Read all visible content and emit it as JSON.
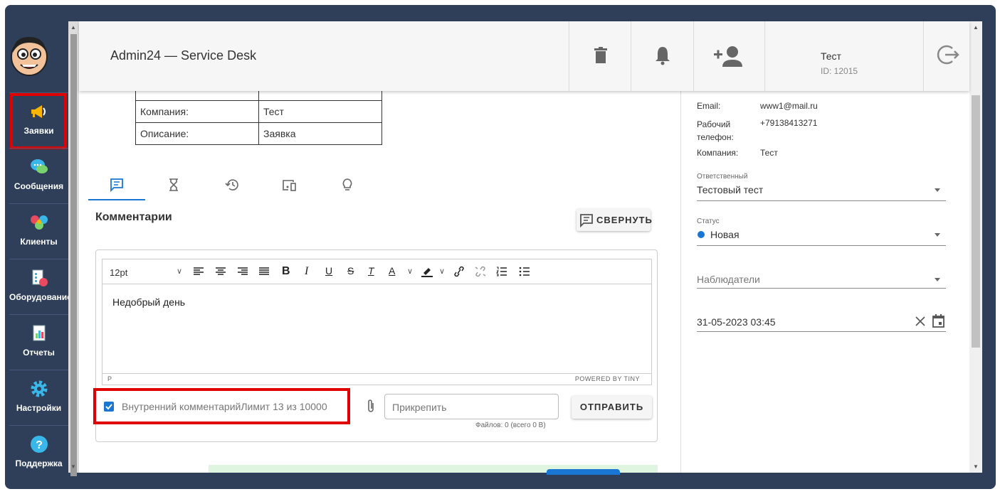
{
  "app": {
    "title": "Admin24 — Service Desk"
  },
  "user": {
    "name": "Тест",
    "id": "ID: 12015"
  },
  "sidebar": {
    "items": [
      {
        "label": "Заявки",
        "icon": "megaphone-icon"
      },
      {
        "label": "Сообщения",
        "icon": "chat-bubbles-icon"
      },
      {
        "label": "Клиенты",
        "icon": "people-icon"
      },
      {
        "label": "Оборудование",
        "icon": "equipment-icon"
      },
      {
        "label": "Отчеты",
        "icon": "report-icon"
      },
      {
        "label": "Настройки",
        "icon": "gear-icon"
      },
      {
        "label": "Поддержка",
        "icon": "help-icon"
      }
    ]
  },
  "ticket": {
    "rows": [
      {
        "key": "Компания:",
        "value": "Тест"
      },
      {
        "key": "Описание:",
        "value": "Заявка"
      }
    ]
  },
  "comments": {
    "title": "Комментарии",
    "collapse_label": "СВЕРНУТЬ",
    "font_size": "12pt",
    "body": "Недобрый день",
    "status_path": "P",
    "powered": "POWERED BY TINY",
    "internal_label": "Внутренний комментарийЛимит 13 из 10000",
    "attach_placeholder": "Прикрепить",
    "files_info": "Файлов: 0 (всего 0 B)",
    "send_label": "ОТПРАВИТЬ"
  },
  "client": {
    "email_key": "Email:",
    "email": "www1@mail.ru",
    "phone_key": "Рабочий телефон:",
    "phone": "+79138413271",
    "company_key": "Компания:",
    "company": "Тест"
  },
  "fields": {
    "responsible_label": "Ответственный",
    "responsible_value": "Тестовый тест",
    "status_label": "Статус",
    "status_value": "Новая",
    "status_color": "#1976d2",
    "observers_placeholder": "Наблюдатели",
    "date_value": "31-05-2023 03:45"
  },
  "colors": {
    "accent": "#1976d2",
    "sidebar_bg": "#2f3f5a",
    "highlight": "#e00000"
  }
}
